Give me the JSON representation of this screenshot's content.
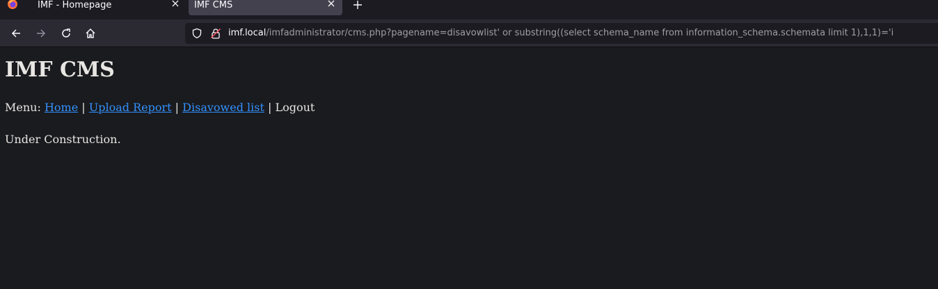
{
  "browser": {
    "tabs": [
      {
        "label": "IMF - Homepage",
        "active": false
      },
      {
        "label": "IMF CMS",
        "active": true
      }
    ],
    "url": {
      "host": "imf.local",
      "path": "/imfadministrator/cms.php?pagename=disavowlist' or substring((select schema_name from information_schema.schemata limit 1),1,1)='i"
    },
    "icons": {
      "logo": "firefox-icon",
      "back": "back-arrow-icon",
      "forward": "forward-arrow-icon",
      "reload": "reload-icon",
      "home": "home-icon",
      "tracking": "shield-icon",
      "security": "lock-icon",
      "new_tab": "plus-icon",
      "close_tab": "close-icon"
    },
    "colors": {
      "tab_strip": "#1c1b22",
      "active_tab": "#42414d",
      "toolbar": "#2b2a33",
      "link": "#3391ff"
    }
  },
  "page": {
    "title": "IMF CMS",
    "menu": {
      "prefix": "Menu:",
      "separator": "|",
      "links": [
        "Home",
        "Upload Report",
        "Disavowed list"
      ],
      "logout": "Logout"
    },
    "status": "Under Construction."
  }
}
